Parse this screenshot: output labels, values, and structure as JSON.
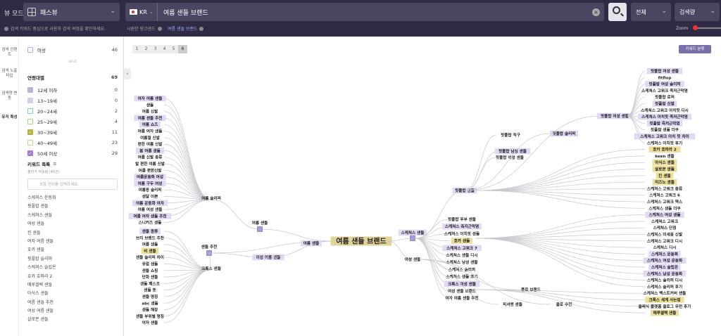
{
  "header": {
    "view_mode_label": "뷰 모드",
    "view_mode_value": "패스뷰",
    "country_code": "KR",
    "search_query": "여름 샌들 브랜드",
    "clear_symbol": "×",
    "scope_select": "전체",
    "metric_select": "검색량",
    "info_text": "검색 키워드 중심으로 사용자 검색 여정을 확인하세요.",
    "chip_1": "시원한 핑크샌드",
    "chip_2": "여름 샌들 브랜드",
    "zoom_label": "Zoom",
    "chevron": "⌄"
  },
  "leftnav": {
    "items": [
      "검색 인텐트",
      "검색 노출타입",
      "검색량 변동",
      "유저 특성"
    ]
  },
  "filters": {
    "gender_label": "여성",
    "gender_count": "46",
    "divider": "and",
    "age_title": "연령대별",
    "age_total": "69",
    "age_groups": [
      {
        "label": "12세 이하",
        "count": "0",
        "color": "#b9b3d6",
        "checked": false
      },
      {
        "label": "13~19세",
        "count": "0",
        "color": "#d3cfe6",
        "checked": false
      },
      {
        "label": "20~24세",
        "count": "2",
        "color": "#7bd0c3",
        "checked": false
      },
      {
        "label": "25~29세",
        "count": "4",
        "color": "#a8d67e",
        "checked": false
      },
      {
        "label": "30~39세",
        "count": "11",
        "color": "#b7b03a",
        "checked": true
      },
      {
        "label": "40~49세",
        "count": "23",
        "color": "#d9cf8c",
        "checked": false
      },
      {
        "label": "50세 이상",
        "count": "29",
        "color": "#a77ad1",
        "checked": true
      }
    ],
    "keyword_list_title": "키워드 목록",
    "keyword_list_sub": "필터가 적용됨 (40건)",
    "keyword_search_placeholder": "포함 단어를 입력하세요.",
    "keywords": [
      "스케쳐스 운동화",
      "핏플랍 샌들",
      "스케쳐스 샌들",
      "여성 샌들",
      "킨 샌들",
      "여자 여름 샌들",
      "호카 샌들",
      "핏플랍 슬리퍼",
      "스케쳐스 슬립온",
      "호카 호파라 2",
      "메루셀렉 샌들",
      "아식스 샌들",
      "여름 샌들 추천",
      "여성 여름 샌들",
      "살로몬 샌들"
    ]
  },
  "canvas": {
    "pages": [
      "1",
      "2",
      "3",
      "4",
      "5",
      "6"
    ],
    "active_page": "6",
    "classify_button": "키워드 분류",
    "collapse_symbol": "‹",
    "center_node": "여름 샌들 브랜드",
    "left_hubs": [
      "여름 샌들",
      "샌들 추천",
      "여성 여름 샌들",
      "여름 슬리퍼",
      "크록스 샌들"
    ],
    "left_leaves_a": [
      "여자 여름 샌들",
      "샌들",
      "여름 신발",
      "여름 샌들 추천",
      "여름 쇼즈",
      "여름 여자 샌들",
      "여름철 신발",
      "편한 여름 신발",
      "봄 여름 샌들",
      "여름 신발 종류",
      "발 편한 여름 신발",
      "여름 편한신발",
      "여름운동화 여성",
      "여름 구두 여성",
      "여름용 슬리퍼",
      "샌달 이쁜",
      "여름 운동화 여자",
      "여름 여성 샌들",
      "여름 여자 샌들 추천",
      "스니커즈 샌들"
    ],
    "left_leaves_b": [
      "샌들 종류",
      "브리 브랜드 추천",
      "여름 샌들",
      "비 샌들",
      "샌들 슬리퍼 차이",
      "유럽 샌들",
      "샌들 쇼핑",
      "단화 샌들",
      "샌들 패스조",
      "샌들 뜻",
      "샌들 명칭",
      "abc 샌들",
      "샌들 해장",
      "샌들 부위별 명칭",
      "여자 샌들"
    ],
    "right_hubs": [
      "스케쳐스 샌들",
      "여성 샌들",
      "핏플랍 샌들",
      "핏플랍 남성 샌들",
      "핏플랍 슬리퍼",
      "핏플랍 여성 샌들",
      "핏플랍 직구",
      "크록스 여성 샌들",
      "플로 브랜드",
      "피셔맨 샌들",
      "클로 추천"
    ],
    "right_mid": [
      "핏플랍 푸부 샌들",
      "스케쳐스 축지근막염",
      "스케쳐스 아치핏 샌들",
      "호카 샌들",
      "스케쳐스 고워크 7",
      "스케쳐스 샌들 디시",
      "스케쳐스 남성 샌들",
      "스케쳐스 슬리퍼",
      "스케쳐스 샌들 후기",
      "크록스 여성 샌들",
      "여성 샌들 브랜드",
      "여자 여름 샌들 추천"
    ],
    "right_leaves": [
      "핏플랍 여성 샌들",
      "fitflop",
      "핏플랍 여성 슬리퍼",
      "스케쳐스 고워크 족저근막염",
      "핏플랍 로퍼",
      "핏플랍 신발",
      "스케쳐스 고워크 아치핏 디시",
      "스케쳐스 아치핏 족저근막염",
      "핏플랍 족저근막염",
      "핏플랍 샌들 더쿠",
      "스케쳐스 고워크 아치 핏 차이",
      "스케쳐스 아치핏 후기",
      "호카 호파라 2",
      "keen 샌들",
      "아식스 샌들",
      "살로몬 샌들",
      "킨 샌들",
      "미즈노 샌들",
      "스케쳐스 고워크 종류",
      "스케쳐스 고워크 6",
      "스케쳐스 고워크 맥스",
      "스케쳐스 샌들 더쿠",
      "스케쳐스 여성 샌들",
      "스케쳐스 고워크",
      "스케쳐스 단점",
      "스케쳐스 미세용 신발",
      "스케쳐스 고워크 디시",
      "스케쳐스 디시",
      "스케쳐스 운동화",
      "스케쳐스 여성 운동화",
      "스케쳐스 슬립온",
      "스케쳐스 남성 운동화",
      "스케쳐스 슬리퍼 디시",
      "스케쳐스 슬리퍼 후기",
      "스케쳐스 백스트커버 샌들",
      "크록스 세계 사는법",
      "클래식 플랫폼 클로그 우먼 후기",
      "메루셀렉 샌들"
    ]
  },
  "colors": {
    "topbar": "#2f2b45",
    "node_purple": "#e2d9f6",
    "node_yellow": "#ecdf9a",
    "node_center": "#e0d49a",
    "link": "#c9c9cf"
  }
}
